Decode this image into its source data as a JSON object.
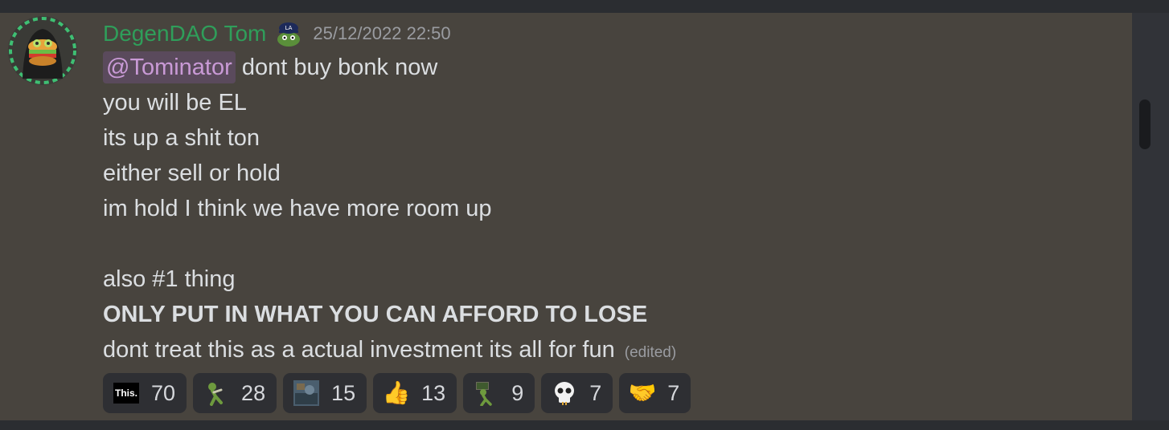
{
  "message": {
    "author": "DegenDAO Tom",
    "timestamp": "25/12/2022 22:50",
    "mention": "@Tominator",
    "lines": [
      "dont buy bonk now",
      "you will be EL",
      "its up a shit ton",
      "either sell or hold",
      "im hold I think we have more room up",
      "",
      "also #1 thing",
      "ONLY PUT IN WHAT YOU CAN AFFORD TO LOSE",
      "dont treat this as a actual investment its all for fun"
    ],
    "edited": "(edited)"
  },
  "reactions": [
    {
      "emoji": "this-emoji",
      "label": "This.",
      "count": "70"
    },
    {
      "emoji": "pepe-walking-emoji",
      "count": "28"
    },
    {
      "emoji": "image-emoji",
      "count": "15"
    },
    {
      "emoji": "thumbs-up-emoji",
      "glyph": "👍",
      "count": "13"
    },
    {
      "emoji": "pepe-sign-emoji",
      "count": "9"
    },
    {
      "emoji": "skull-emoji",
      "count": "7"
    },
    {
      "emoji": "handshake-emoji",
      "glyph": "🤝",
      "count": "7"
    }
  ],
  "colors": {
    "username": "#2f9e5a",
    "mention_text": "#c99ad6",
    "mention_bg": "#5a4a5c",
    "message_bg": "#48443e",
    "reaction_bg": "#2e2f33"
  }
}
